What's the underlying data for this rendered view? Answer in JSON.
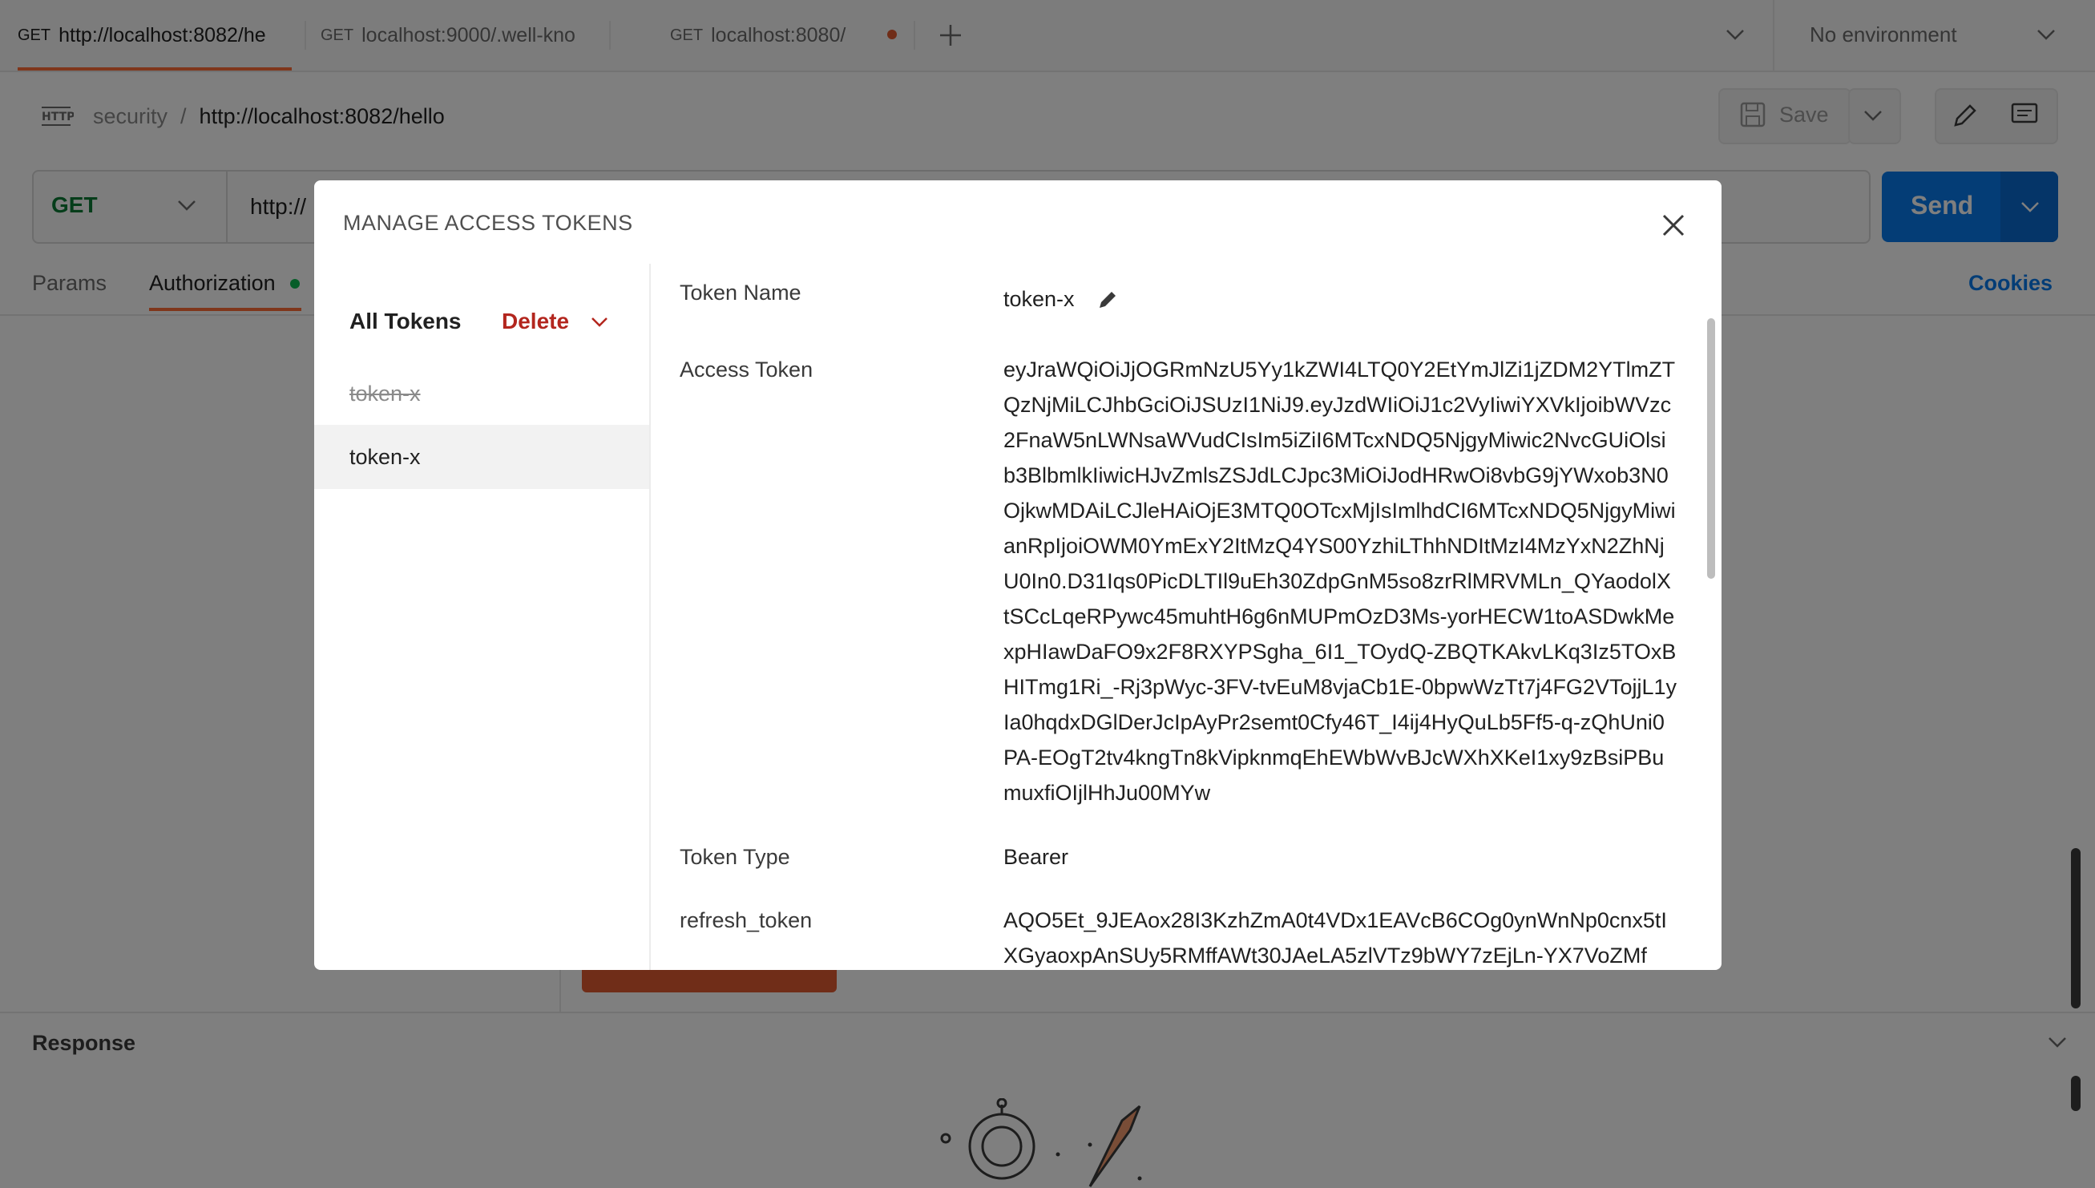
{
  "tabs": [
    {
      "method": "GET",
      "label": "http://localhost:8082/he",
      "active": true
    },
    {
      "method": "GET",
      "label": "localhost:9000/.well-kno",
      "active": false
    },
    {
      "method": "GET",
      "label": "localhost:8080/",
      "active": false,
      "unsaved": true
    }
  ],
  "environment": {
    "label": "No environment"
  },
  "breadcrumb": {
    "collection": "security",
    "separator": "/",
    "request": "http://localhost:8082/hello"
  },
  "toolbar": {
    "save_label": "Save"
  },
  "request": {
    "method": "GET",
    "url": "http://",
    "send_label": "Send"
  },
  "subtabs": {
    "params": "Params",
    "authorization": "Authorization",
    "cookies": "Cookies"
  },
  "response": {
    "label": "Response"
  },
  "modal": {
    "title": "MANAGE ACCESS TOKENS",
    "sidebar": {
      "all_tokens": "All Tokens",
      "delete": "Delete",
      "tokens": [
        {
          "name": "token-x",
          "expired": true
        },
        {
          "name": "token-x",
          "expired": false,
          "selected": true
        }
      ]
    },
    "details": {
      "token_name_label": "Token Name",
      "token_name_value": "token-x",
      "access_token_label": "Access Token",
      "access_token_value": "eyJraWQiOiJjOGRmNzU5Yy1kZWI4LTQ0Y2EtYmJlZi1jZDM2YTlmZTQzNjMiLCJhbGciOiJSUzI1NiJ9.eyJzdWIiOiJ1c2VyIiwiYXVkIjoibWVzc2FnaW5nLWNsaWVudCIsIm5iZiI6MTcxNDQ5NjgyMiwic2NvcGUiOlsib3BlbmlkIiwicHJvZmlsZSJdLCJpc3MiOiJodHRwOi8vbG9jYWxob3N0OjkwMDAiLCJleHAiOjE3MTQ0OTcxMjIsImlhdCI6MTcxNDQ5NjgyMiwianRpIjoiOWM0YmExY2ItMzQ4YS00YzhiLThhNDItMzI4MzYxN2ZhNjU0In0.D31Iqs0PicDLTIl9uEh30ZdpGnM5so8zrRlMRVMLn_QYaodolXtSCcLqeRPywc45muhtH6g6nMUPmOzD3Ms-yorHECW1toASDwkMexpHIawDaFO9x2F8RXYPSgha_6I1_TOydQ-ZBQTKAkvLKq3Iz5TOxBHITmg1Ri_-Rj3pWyc-3FV-tvEuM8vjaCb1E-0bpwWzTt7j4FG2VTojjL1yIa0hqdxDGlDerJcIpAyPr2semt0Cfy46T_I4ij4HyQuLb5Ff5-q-zQhUni0PA-EOgT2tv4kngTn8kVipknmqEhEWbWvBJcWXhXKeI1xy9zBsiPBumuxfiOIjlHhJu00MYw",
      "token_type_label": "Token Type",
      "token_type_value": "Bearer",
      "refresh_token_label": "refresh_token",
      "refresh_token_value": "AQO5Et_9JEAox28I3KzhZmA0t4VDx1EAVcB6COg0ynWnNp0cnx5tIXGyaoxpAnSUy5RMffAWt30JAeLA5zlVTz9bWY7zEjLn-YX7VoZMf"
    }
  },
  "colors": {
    "accent": "#ff6c37",
    "send": "#097bed",
    "delete": "#b3261e",
    "get_method": "#0a7a35"
  }
}
